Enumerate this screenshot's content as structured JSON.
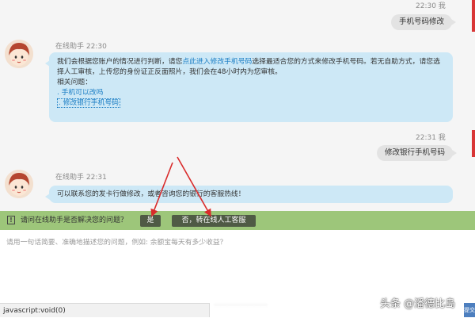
{
  "chat": {
    "messages": [
      {
        "type": "user",
        "time": "22:30 我",
        "text": "手机号码修改"
      },
      {
        "type": "agent",
        "sender": "在线助手",
        "time": "22:30",
        "text_pre": "我们会根据您账户的情况进行判断，请您",
        "text_link": "点此进入修改手机号码",
        "text_post": "选择最适合您的方式来修改手机号码。若无自助方式，请您选择人工审核，上传您的身份证正反面照片，我们会在48小时内为您审核。",
        "related_title": "相关问题：",
        "related": [
          ". 手机可以改吗",
          ". 修改银行手机号码"
        ]
      },
      {
        "type": "user",
        "time": "22:31 我",
        "text": "修改银行手机号码"
      },
      {
        "type": "agent",
        "sender": "在线助手",
        "time": "22:31",
        "text": "可以联系您的发卡行做修改，或者咨询您的银行的客服热线！"
      }
    ]
  },
  "feedback": {
    "icon": "exclamation-icon",
    "question": "请问在线助手是否解决您的问题？",
    "yes_label": "是",
    "no_label": "否，转在线人工客服"
  },
  "input": {
    "placeholder": "请用一句话简要、准确地描述您的问题，例如: 余额宝每天有多少收益？"
  },
  "status_bar": {
    "text": "javascript:void(0)"
  },
  "watermark": "头条 @潘德比岛",
  "corner_button": "提交",
  "colors": {
    "agent_bubble": "#cde8f6",
    "user_bubble": "#e3e3e3",
    "feedback_bar": "#9dc67a",
    "feedback_button": "#4f5a45",
    "link": "#1a7dc4",
    "annotation_arrow": "#d92b2b"
  }
}
